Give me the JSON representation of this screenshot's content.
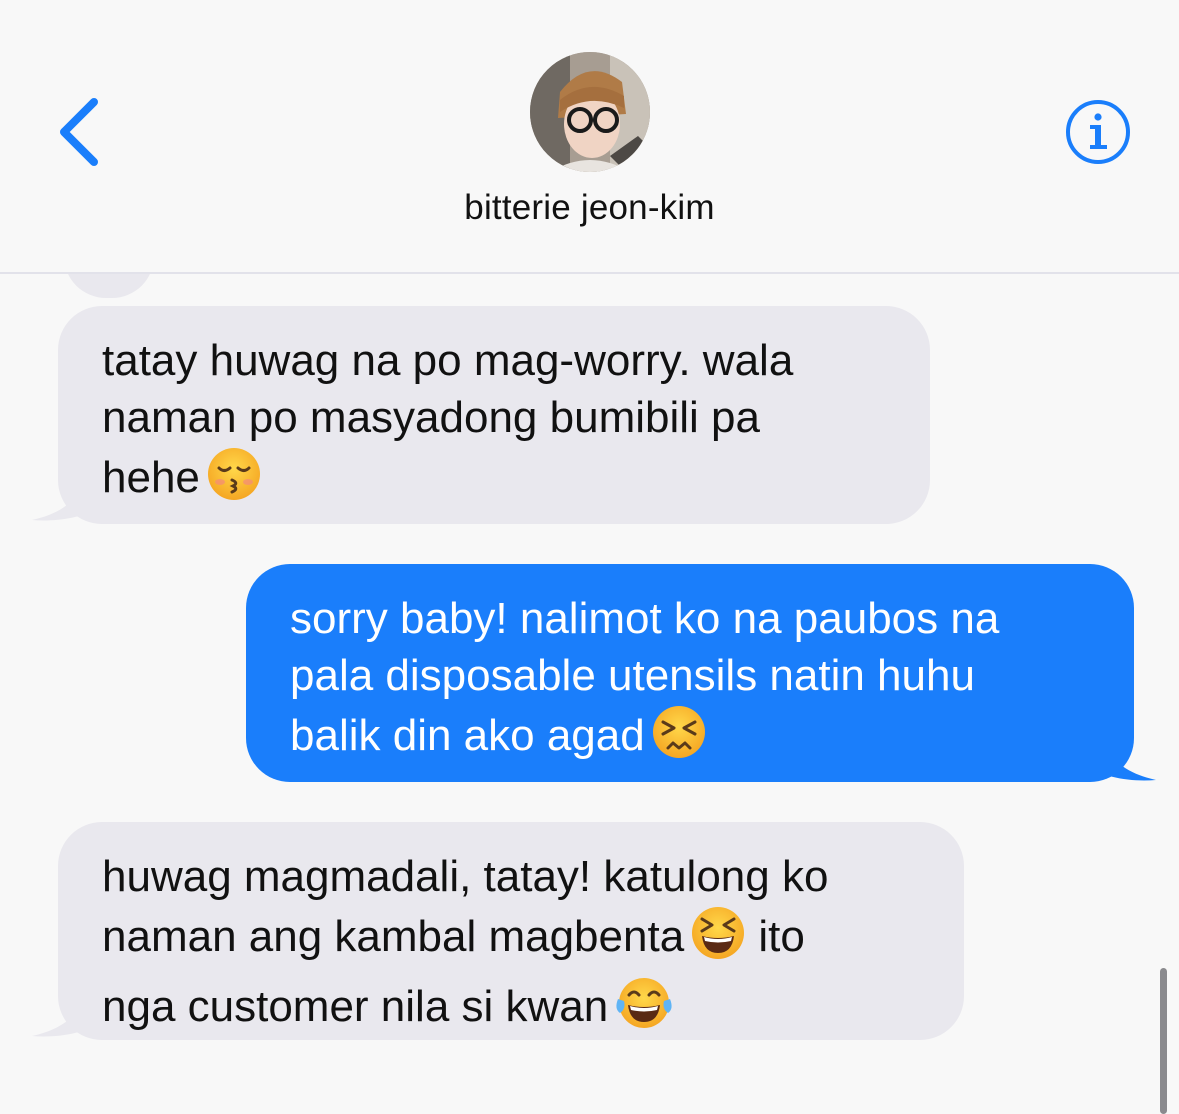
{
  "header": {
    "contact_name": "bitterie jeon-kim",
    "back_icon": "chevron-left-icon",
    "info_icon": "info-circle-icon",
    "accent_color": "#1a7efb"
  },
  "messages": [
    {
      "direction": "received",
      "lines": [
        "tatay huwag na po mag-worry. wala",
        "naman po masyadong bumibili pa",
        "hehe"
      ],
      "emoji": [
        "kissing-face-with-closed-eyes"
      ]
    },
    {
      "direction": "sent",
      "lines": [
        "sorry baby! nalimot ko na paubos na",
        "pala disposable utensils natin huhu",
        "balik din ako agad"
      ],
      "emoji": [
        "confounded-face"
      ]
    },
    {
      "direction": "received",
      "lines": [
        "huwag magmadali, tatay! katulong ko",
        "naman ang kambal magbenta",
        "ito",
        "nga customer nila si kwan"
      ],
      "emoji": [
        "grinning-squinting-face",
        "face-with-tears-of-joy"
      ]
    }
  ],
  "colors": {
    "received_bubble": "#e9e8ee",
    "sent_bubble": "#1a7efb",
    "background": "#f8f8f8"
  }
}
